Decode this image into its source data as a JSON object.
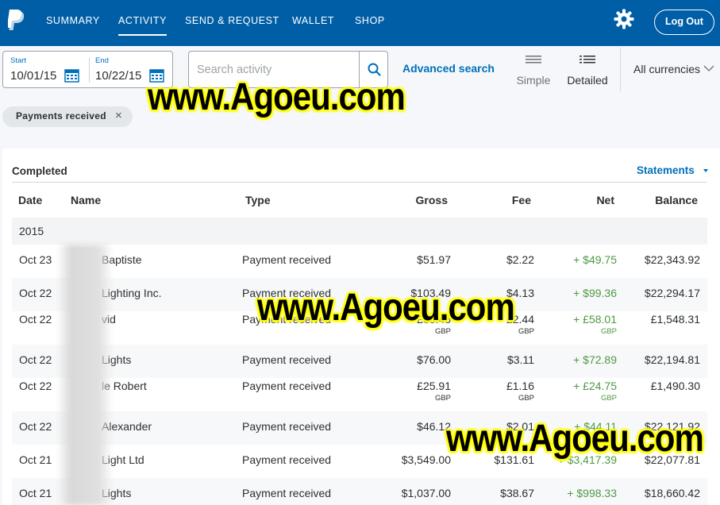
{
  "nav": {
    "items": [
      "SUMMARY",
      "ACTIVITY",
      "SEND & REQUEST",
      "WALLET",
      "SHOP"
    ],
    "active": "ACTIVITY",
    "logout_label": "Log Out"
  },
  "filters": {
    "start_label": "Start",
    "start_value": "10/01/15",
    "end_label": "End",
    "end_value": "10/22/15",
    "search_placeholder": "Search activity",
    "advanced_search": "Advanced search",
    "view_simple": "Simple",
    "view_detailed": "Detailed",
    "currency": "All currencies",
    "chip": "Payments received"
  },
  "table": {
    "section_title": "Completed",
    "statements_label": "Statements",
    "headers": {
      "date": "Date",
      "name": "Name",
      "type": "Type",
      "gross": "Gross",
      "fee": "Fee",
      "net": "Net",
      "balance": "Balance"
    },
    "year": "2015",
    "rows": [
      {
        "date": "Oct 23",
        "name": "Baptiste",
        "type": "Payment received",
        "gross": "$51.97",
        "gross_cur": "",
        "fee": "$2.22",
        "fee_cur": "",
        "net": "+ $49.75",
        "net_cur": "",
        "balance": "$22,343.92"
      },
      {
        "date": "Oct 22",
        "name": "Lighting Inc.",
        "type": "Payment received",
        "gross": "$103.49",
        "gross_cur": "",
        "fee": "$4.13",
        "fee_cur": "",
        "net": "+ $99.36",
        "net_cur": "",
        "balance": "$22,294.17"
      },
      {
        "date": "Oct 22",
        "name": "vid",
        "type": "Payment received",
        "gross": "£60.45",
        "gross_cur": "GBP",
        "fee": "£2.44",
        "fee_cur": "GBP",
        "net": "+ £58.01",
        "net_cur": "GBP",
        "balance": "£1,548.31"
      },
      {
        "date": "Oct 22",
        "name": "Lights",
        "type": "Payment received",
        "gross": "$76.00",
        "gross_cur": "",
        "fee": "$3.11",
        "fee_cur": "",
        "net": "+ $72.89",
        "net_cur": "",
        "balance": "$22,194.81"
      },
      {
        "date": "Oct 22",
        "name": "le Robert",
        "type": "Payment received",
        "gross": "£25.91",
        "gross_cur": "GBP",
        "fee": "£1.16",
        "fee_cur": "GBP",
        "net": "+ £24.75",
        "net_cur": "GBP",
        "balance": "£1,490.30"
      },
      {
        "date": "Oct 22",
        "name": "Alexander",
        "type": "Payment received",
        "gross": "$46.12",
        "gross_cur": "",
        "fee": "$2.01",
        "fee_cur": "",
        "net": "+ $44.11",
        "net_cur": "",
        "balance": "$22,121.92"
      },
      {
        "date": "Oct 21",
        "name": "Light Ltd",
        "type": "Payment received",
        "gross": "$3,549.00",
        "gross_cur": "",
        "fee": "$131.61",
        "fee_cur": "",
        "net": "+ $3,417.39",
        "net_cur": "",
        "balance": "$22,077.81"
      },
      {
        "date": "Oct 21",
        "name": "Lights",
        "type": "Payment received",
        "gross": "$1,037.00",
        "gross_cur": "",
        "fee": "$38.67",
        "fee_cur": "",
        "net": "+ $998.33",
        "net_cur": "",
        "balance": "$18,660.42"
      }
    ]
  },
  "watermark": "www.Agoeu.com",
  "colors": {
    "nav_bg": "#005ea6",
    "link": "#0070ba",
    "positive": "#4d9a43"
  }
}
